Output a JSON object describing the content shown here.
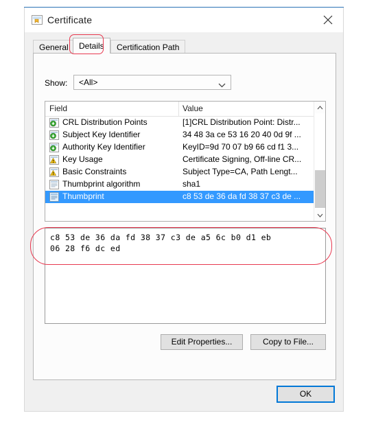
{
  "window": {
    "title": "Certificate",
    "icon": "certificate-icon",
    "close_icon": "close-icon"
  },
  "tabs": [
    {
      "label": "General",
      "selected": false
    },
    {
      "label": "Details",
      "selected": true
    },
    {
      "label": "Certification Path",
      "selected": false
    }
  ],
  "show_filter": {
    "label": "Show:",
    "value": "<All>",
    "dropdown_icon": "chevron-down-icon"
  },
  "field_list": {
    "columns": [
      "Field",
      "Value"
    ],
    "rows": [
      {
        "icon": "extension-green-arrow-icon",
        "field": "CRL Distribution Points",
        "value": "[1]CRL Distribution Point: Distr...",
        "selected": false
      },
      {
        "icon": "extension-green-arrow-icon",
        "field": "Subject Key Identifier",
        "value": "34 48 3a ce 53 16 20 40 0d 9f ...",
        "selected": false
      },
      {
        "icon": "extension-green-arrow-icon",
        "field": "Authority Key Identifier",
        "value": "KeyID=9d 70 07 b9 66 cd f1 3...",
        "selected": false
      },
      {
        "icon": "extension-warning-icon",
        "field": "Key Usage",
        "value": "Certificate Signing, Off-line CR...",
        "selected": false
      },
      {
        "icon": "extension-warning-icon",
        "field": "Basic Constraints",
        "value": "Subject Type=CA, Path Lengt...",
        "selected": false
      },
      {
        "icon": "property-document-icon",
        "field": "Thumbprint algorithm",
        "value": "sha1",
        "selected": false
      },
      {
        "icon": "property-document-icon",
        "field": "Thumbprint",
        "value": "c8 53 de 36 da fd 38 37 c3 de ...",
        "selected": true
      }
    ],
    "scrollbar": {
      "up_icon": "chevron-up-icon",
      "down_icon": "chevron-down-icon"
    }
  },
  "detail_value": "c8 53 de 36 da fd 38 37 c3 de a5 6c b0 d1 eb\n06 28 f6 dc ed",
  "buttons": {
    "edit_properties": "Edit Properties...",
    "copy_to_file": "Copy to File...",
    "ok": "OK"
  },
  "colors": {
    "selection_blue": "#3399ff",
    "focus_blue": "#0078d7",
    "annotation_red": "#e8384f",
    "dialog_bg": "#f0f0f0",
    "panel_bg": "#fcfcfc"
  }
}
